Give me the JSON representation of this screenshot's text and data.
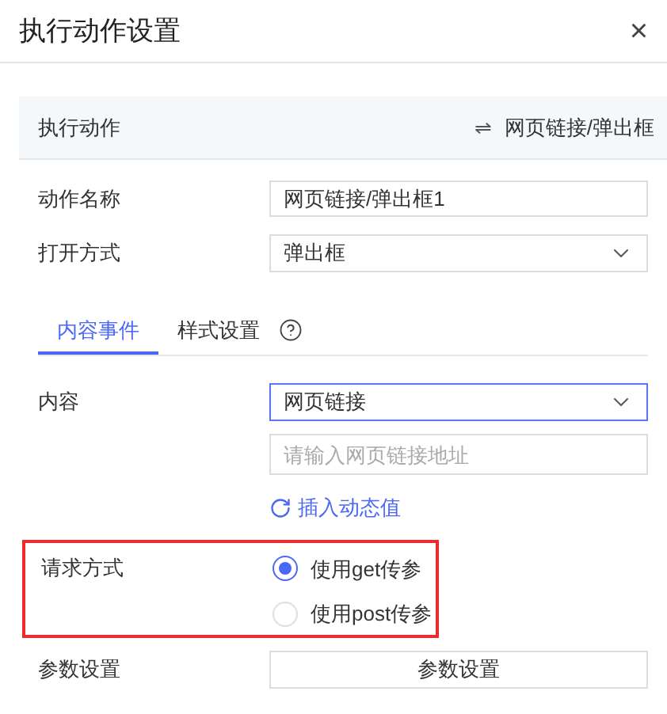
{
  "dialog": {
    "title": "执行动作设置",
    "close": "×"
  },
  "action_bar": {
    "label": "执行动作",
    "value": "网页链接/弹出框",
    "swap_icon": "⇌"
  },
  "fields": [
    {
      "kind": "input",
      "label": "动作名称",
      "value": "网页链接/弹出框1"
    },
    {
      "kind": "select",
      "label": "打开方式",
      "value": "弹出框"
    }
  ],
  "tabs": [
    {
      "label": "内容事件",
      "selected": true
    },
    {
      "label": "样式设置",
      "selected": false
    }
  ],
  "content": {
    "label": "内容",
    "select_value": "网页链接",
    "url_placeholder": "请输入网页链接地址",
    "insert_link": "插入动态值"
  },
  "request": {
    "label": "请求方式",
    "highlighted": true,
    "options": [
      {
        "label": "使用get传参",
        "selected": true
      },
      {
        "label": "使用post传参",
        "selected": false
      }
    ]
  },
  "params": {
    "label": "参数设置",
    "button": "参数设置"
  }
}
